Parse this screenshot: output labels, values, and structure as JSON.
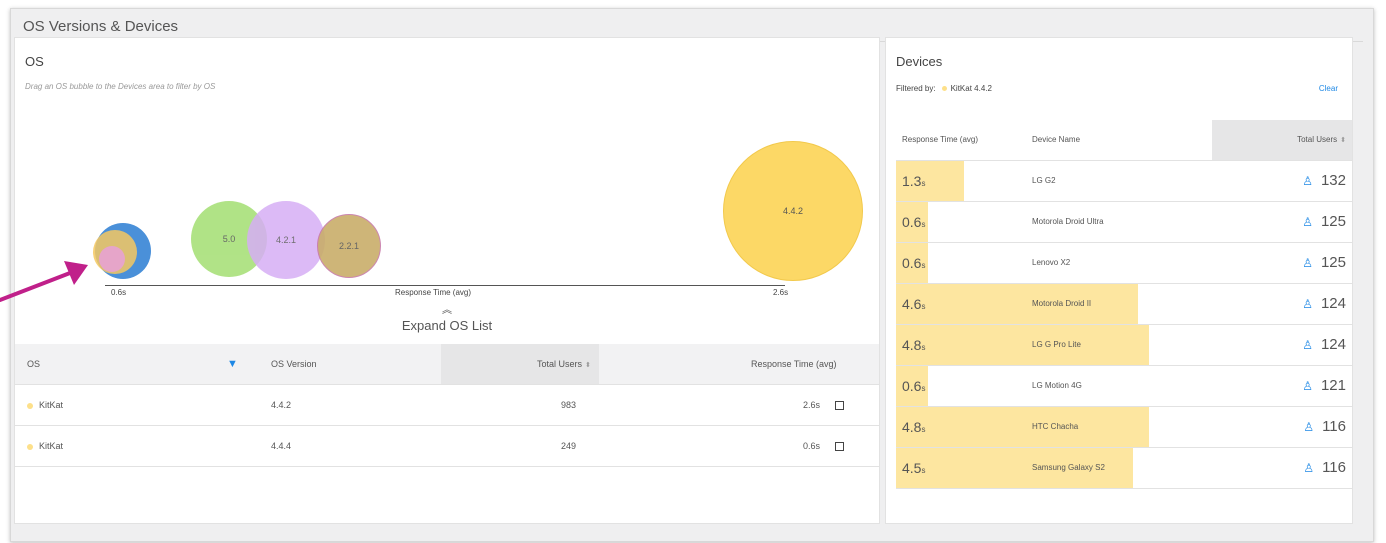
{
  "title": "OS Versions & Devices",
  "os_panel": {
    "title": "OS",
    "subtitle": "Drag an OS bubble to the Devices area to filter by OS",
    "bubbles": [
      {
        "label": "",
        "color": "#4a90d9"
      },
      {
        "label": "",
        "color": "#f5c860"
      },
      {
        "label": "",
        "color": "#e8a0d8"
      },
      {
        "label": "5.0",
        "color": "#a8e07a"
      },
      {
        "label": "4.2.1",
        "color": "#d6aef5"
      },
      {
        "label": "2.2.1",
        "color": "#c9ad6a"
      },
      {
        "label": "4.4.2",
        "color": "#fcd866"
      }
    ],
    "axis": {
      "min_label": "0.6s",
      "max_label": "2.6s",
      "label": "Response Time (avg)"
    },
    "expand_label": "Expand OS List",
    "expand_icon": "double-chevron-up-icon",
    "table": {
      "headers": {
        "os": "OS",
        "os_version": "OS Version",
        "total_users": "Total Users",
        "response_time": "Response Time (avg)"
      },
      "filter_icon": "funnel-icon",
      "rows": [
        {
          "os": "KitKat",
          "os_version": "4.4.2",
          "total_users": "983",
          "response_time": "2.6s"
        },
        {
          "os": "KitKat",
          "os_version": "4.4.4",
          "total_users": "249",
          "response_time": "0.6s"
        }
      ]
    }
  },
  "devices_panel": {
    "title": "Devices",
    "filtered_by_label": "Filtered by:",
    "filter_value": "KitKat 4.4.2",
    "clear_label": "Clear",
    "headers": {
      "response_time": "Response Time (avg)",
      "device_name": "Device Name",
      "total_users": "Total Users"
    },
    "bar_max_seconds": 6.0,
    "rows": [
      {
        "rt_value": "1.3",
        "rt_unit": "s",
        "rt_seconds": 1.3,
        "name": "LG G2",
        "users": "132"
      },
      {
        "rt_value": "0.6",
        "rt_unit": "s",
        "rt_seconds": 0.6,
        "name": "Motorola Droid Ultra",
        "users": "125"
      },
      {
        "rt_value": "0.6",
        "rt_unit": "s",
        "rt_seconds": 0.6,
        "name": "Lenovo X2",
        "users": "125"
      },
      {
        "rt_value": "4.6",
        "rt_unit": "s",
        "rt_seconds": 4.6,
        "name": "Motorola Droid II",
        "users": "124"
      },
      {
        "rt_value": "4.8",
        "rt_unit": "s",
        "rt_seconds": 4.8,
        "name": "LG G Pro Lite",
        "users": "124"
      },
      {
        "rt_value": "0.6",
        "rt_unit": "s",
        "rt_seconds": 0.6,
        "name": "LG Motion 4G",
        "users": "121"
      },
      {
        "rt_value": "4.8",
        "rt_unit": "s",
        "rt_seconds": 4.8,
        "name": "HTC Chacha",
        "users": "116"
      },
      {
        "rt_value": "4.5",
        "rt_unit": "s",
        "rt_seconds": 4.5,
        "name": "Samsung Galaxy S2",
        "users": "116"
      }
    ]
  },
  "annotation": {
    "arrow_color": "#c0208a"
  }
}
